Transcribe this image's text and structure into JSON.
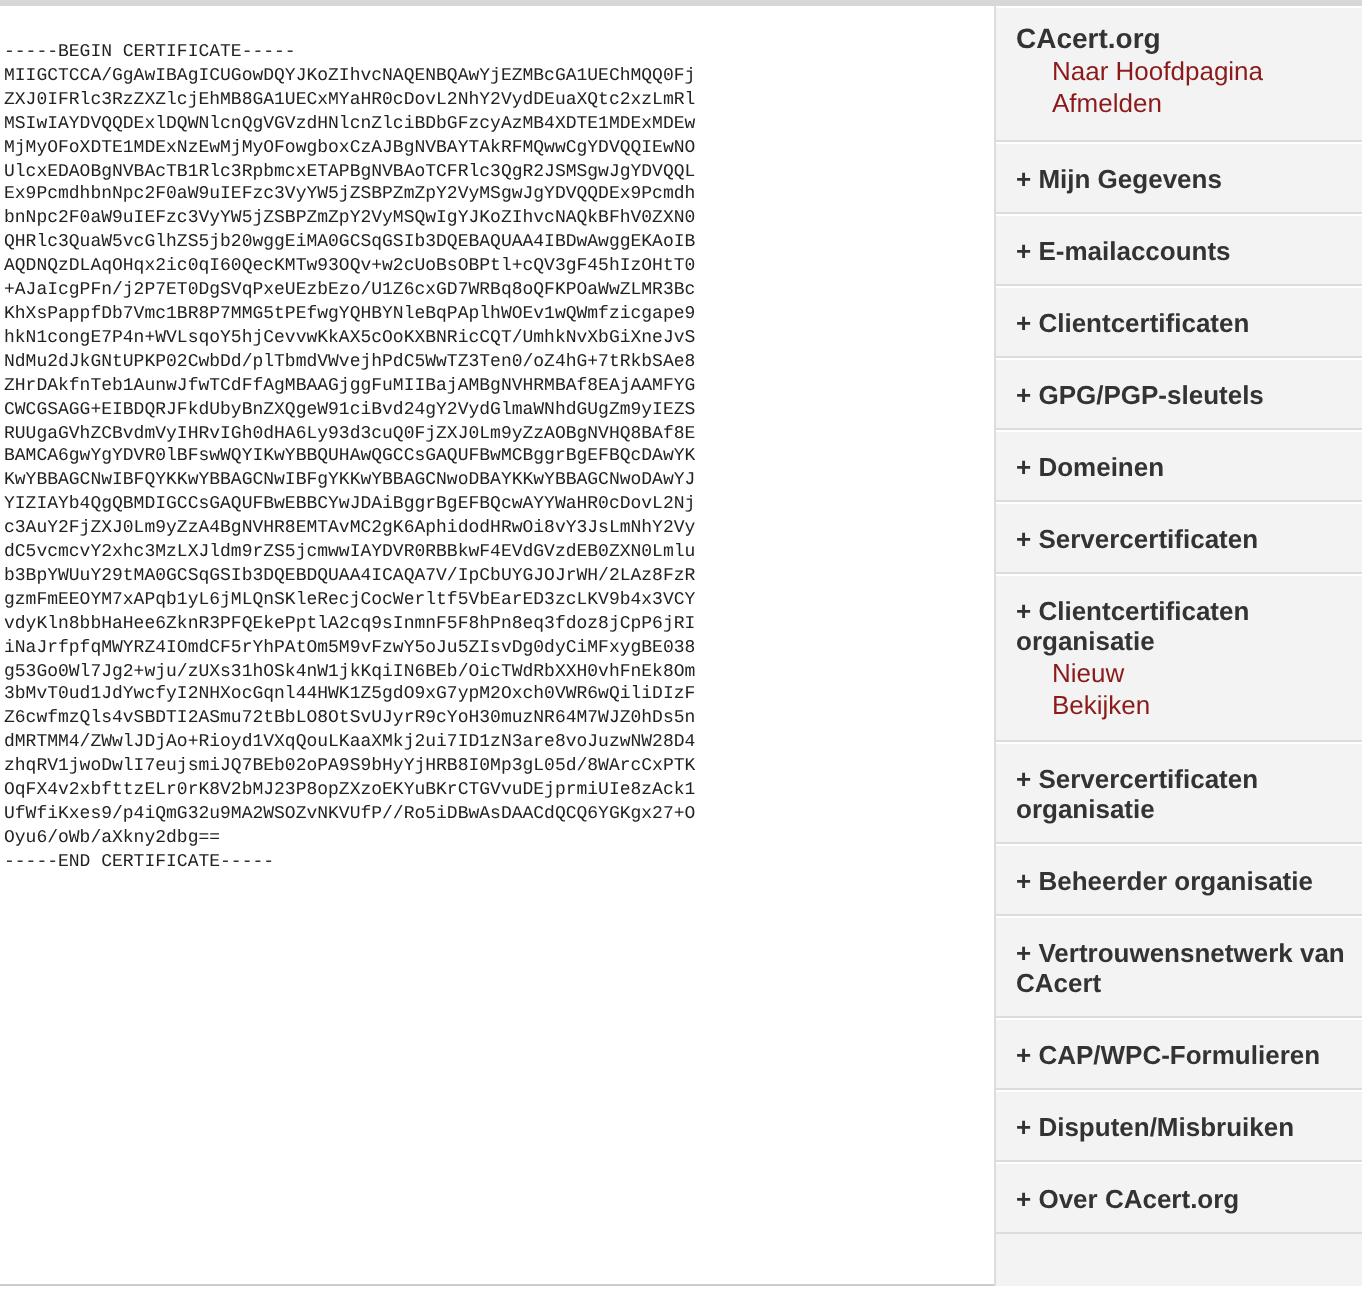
{
  "certificate": {
    "begin": "-----BEGIN CERTIFICATE-----",
    "lines": [
      "MIIGCTCCA/GgAwIBAgICUGowDQYJKoZIhvcNAQENBQAwYjEZMBcGA1UEChMQQ0Fj",
      "ZXJ0IFRlc3RzZXZlcjEhMB8GA1UECxMYaHR0cDovL2NhY2VydDEuaXQtc2xzLmRl",
      "MSIwIAYDVQQDExlDQWNlcnQgVGVzdHNlcnZlciBDbGFzcyAzMB4XDTE1MDExMDEw",
      "MjMyOFoXDTE1MDExNzEwMjMyOFowgboxCzAJBgNVBAYTAkRFMQwwCgYDVQQIEwNO",
      "UlcxEDAOBgNVBAcTB1Rlc3RpbmcxETAPBgNVBAoTCFRlc3QgR2JSMSgwJgYDVQQL",
      "Ex9PcmdhbnNpc2F0aW9uIEFzc3VyYW5jZSBPZmZpY2VyMSgwJgYDVQQDEx9Pcmdh",
      "bnNpc2F0aW9uIEFzc3VyYW5jZSBPZmZpY2VyMSQwIgYJKoZIhvcNAQkBFhV0ZXN0",
      "QHRlc3QuaW5vcGlhZS5jb20wggEiMA0GCSqGSIb3DQEBAQUAA4IBDwAwggEKAoIB",
      "AQDNQzDLAqOHqx2ic0qI60QecKMTw93OQv+w2cUoBsOBPtl+cQV3gF45hIzOHtT0",
      "+AJaIcgPFn/j2P7ET0DgSVqPxeUEzbEzo/U1Z6cxGD7WRBq8oQFKPOaWwZLMR3Bc",
      "KhXsPappfDb7Vmc1BR8P7MMG5tPEfwgYQHBYNleBqPAplhWOEv1wQWmfzicgape9",
      "hkN1congE7P4n+WVLsqoY5hjCevvwKkAX5cOoKXBNRicCQT/UmhkNvXbGiXneJvS",
      "NdMu2dJkGNtUPKP02CwbDd/plTbmdVWvejhPdC5WwTZ3Ten0/oZ4hG+7tRkbSAe8",
      "ZHrDAkfnTeb1AunwJfwTCdFfAgMBAAGjggFuMIIBajAMBgNVHRMBAf8EAjAAMFYG",
      "CWCGSAGG+EIBDQRJFkdUbyBnZXQgeW91ciBvd24gY2VydGlmaWNhdGUgZm9yIEZS",
      "RUUgaGVhZCBvdmVyIHRvIGh0dHA6Ly93d3cuQ0FjZXJ0Lm9yZzAOBgNVHQ8BAf8E",
      "BAMCA6gwYgYDVR0lBFswWQYIKwYBBQUHAwQGCCsGAQUFBwMCBggrBgEFBQcDAwYK",
      "KwYBBAGCNwIBFQYKKwYBBAGCNwIBFgYKKwYBBAGCNwoDBAYKKwYBBAGCNwoDAwYJ",
      "YIZIAYb4QgQBMDIGCCsGAQUFBwEBBCYwJDAiBggrBgEFBQcwAYYWaHR0cDovL2Nj",
      "c3AuY2FjZXJ0Lm9yZzA4BgNVHR8EMTAvMC2gK6AphidodHRwOi8vY3JsLmNhY2Vy",
      "dC5vcmcvY2xhc3MzLXJldm9rZS5jcmwwIAYDVR0RBBkwF4EVdGVzdEB0ZXN0Lmlu",
      "b3BpYWUuY29tMA0GCSqGSIb3DQEBDQUAA4ICAQA7V/IpCbUYGJOJrWH/2LAz8FzR",
      "gzmFmEEOYM7xAPqb1yL6jMLQnSKleRecjCocWerltf5VbEarED3zcLKV9b4x3VCY",
      "vdyKln8bbHaHee6ZknR3PFQEkePptlA2cq9sInmnF5F8hPn8eq3fdoz8jCpP6jRI",
      "iNaJrfpfqMWYRZ4IOmdCF5rYhPAtOm5M9vFzwY5oJu5ZIsvDg0dyCiMFxygBE038",
      "g53Go0Wl7Jg2+wju/zUXs31hOSk4nW1jkKqiIN6BEb/OicTWdRbXXH0vhFnEk8Om",
      "3bMvT0ud1JdYwcfyI2NHXocGqnl44HWK1Z5gdO9xG7ypM2Oxch0VWR6wQiliDIzF",
      "Z6cwfmzQls4vSBDTI2ASmu72tBbLO8OtSvUJyrR9cYoH30muzNR64M7WJZ0hDs5n",
      "dMRTMM4/ZWwlJDjAo+Rioyd1VXqQouLKaaXMkj2ui7ID1zN3are8voJuzwNW28D4",
      "zhqRV1jwoDwlI7eujsmiJQ7BEb02oPA9S9bHyYjHRB8I0Mp3gL05d/8WArcCxPTK",
      "OqFX4v2xbfttzELr0rK8V2bMJ23P8opZXzoEKYuBKrCTGVvuDEjprmiUIe8zAck1",
      "UfWfiKxes9/p4iQmG32u9MA2WSOZvNKVUfP//Ro5iDBwAsDAACdQCQ6YGKgx27+O",
      "Oyu6/oWb/aXkny2dbg=="
    ],
    "end": "-----END CERTIFICATE-----"
  },
  "sidebar": {
    "items": [
      {
        "marker": "",
        "label": "CAcert.org",
        "children": [
          {
            "label": "Naar Hoofdpagina"
          },
          {
            "label": "Afmelden"
          }
        ]
      },
      {
        "marker": "+",
        "label": "Mijn Gegevens"
      },
      {
        "marker": "+",
        "label": "E-mailaccounts"
      },
      {
        "marker": "+",
        "label": "Clientcertificaten"
      },
      {
        "marker": "+",
        "label": "GPG/PGP-sleutels"
      },
      {
        "marker": "+",
        "label": "Domeinen"
      },
      {
        "marker": "+",
        "label": "Servercertificaten"
      },
      {
        "marker": "+",
        "label": "Clientcertificaten organisatie",
        "children": [
          {
            "label": "Nieuw"
          },
          {
            "label": "Bekijken"
          }
        ]
      },
      {
        "marker": "+",
        "label": "Servercertificaten organisatie"
      },
      {
        "marker": "+",
        "label": "Beheerder organisatie"
      },
      {
        "marker": "+",
        "label": "Vertrouwensnetwerk van CAcert"
      },
      {
        "marker": "+",
        "label": "CAP/WPC-Formulieren"
      },
      {
        "marker": "+",
        "label": "Disputen/Misbruiken"
      },
      {
        "marker": "+",
        "label": "Over CAcert.org"
      }
    ]
  }
}
